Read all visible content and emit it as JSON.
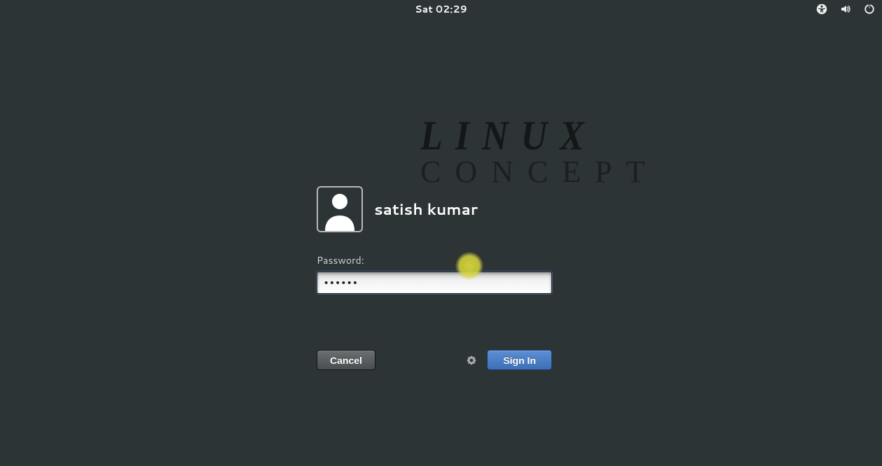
{
  "topbar": {
    "clock": "Sat 02:29"
  },
  "watermark": {
    "line1": "LINUX",
    "line2": "CONCEPT"
  },
  "login": {
    "username": "satish kumar",
    "password_label": "Password:",
    "password_value": "••••••",
    "cancel_label": "Cancel",
    "signin_label": "Sign In"
  },
  "icons": {
    "accessibility": "accessibility-icon",
    "volume": "volume-icon",
    "power": "power-icon",
    "avatar": "avatar-icon",
    "session_gear": "gear-icon"
  }
}
